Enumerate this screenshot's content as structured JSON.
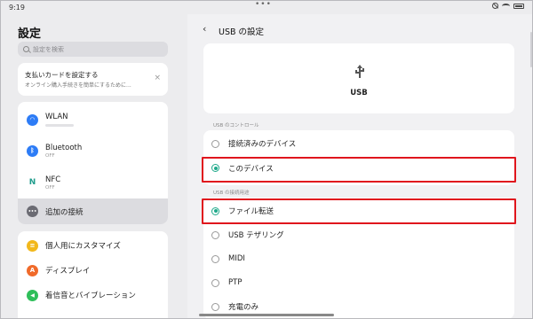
{
  "status": {
    "time": "9:19",
    "dots": "•••"
  },
  "left": {
    "title": "設定",
    "search_placeholder": "設定を検索",
    "promo": {
      "title": "支払いカードを設定する",
      "subtitle": "オンライン購入手続きを簡単にするために...",
      "close": "×"
    },
    "connections": [
      {
        "label": "WLAN",
        "icon": "wifi-icon",
        "color": "#2d7cf6",
        "glyph": "◠"
      },
      {
        "label": "Bluetooth",
        "sub": "OFF",
        "icon": "bluetooth-icon",
        "color": "#2d7cf6",
        "glyph": "ᛒ"
      },
      {
        "label": "NFC",
        "sub": "OFF",
        "icon": "nfc-icon",
        "color": "#ffffff",
        "glyph": "N"
      },
      {
        "label": "追加の接続",
        "icon": "more-icon",
        "color": "#6b6b73",
        "glyph": "•••"
      }
    ],
    "display_items": [
      {
        "label": "個人用にカスタマイズ",
        "icon": "personalize-icon",
        "color": "#f2b81c",
        "glyph": "≡"
      },
      {
        "label": "ディスプレイ",
        "icon": "display-icon",
        "color": "#f06a2a",
        "glyph": "A"
      },
      {
        "label": "着信音とバイブレーション",
        "icon": "sound-icon",
        "color": "#2fbf5a",
        "glyph": "◀"
      }
    ]
  },
  "right": {
    "back": "‹",
    "title": "USB の設定",
    "usb_label": "USB",
    "control_section": "USB のコントロール",
    "control_options": [
      {
        "label": "接続済みのデバイス",
        "selected": false
      },
      {
        "label": "このデバイス",
        "selected": true
      }
    ],
    "purpose_section": "USB の接続用途",
    "purpose_options": [
      {
        "label": "ファイル転送",
        "selected": true
      },
      {
        "label": "USB テザリング",
        "selected": false
      },
      {
        "label": "MIDI",
        "selected": false
      },
      {
        "label": "PTP",
        "selected": false
      },
      {
        "label": "充電のみ",
        "selected": false
      }
    ]
  },
  "colors": {
    "accent": "#1fa98a",
    "highlight": "#e0161d"
  }
}
